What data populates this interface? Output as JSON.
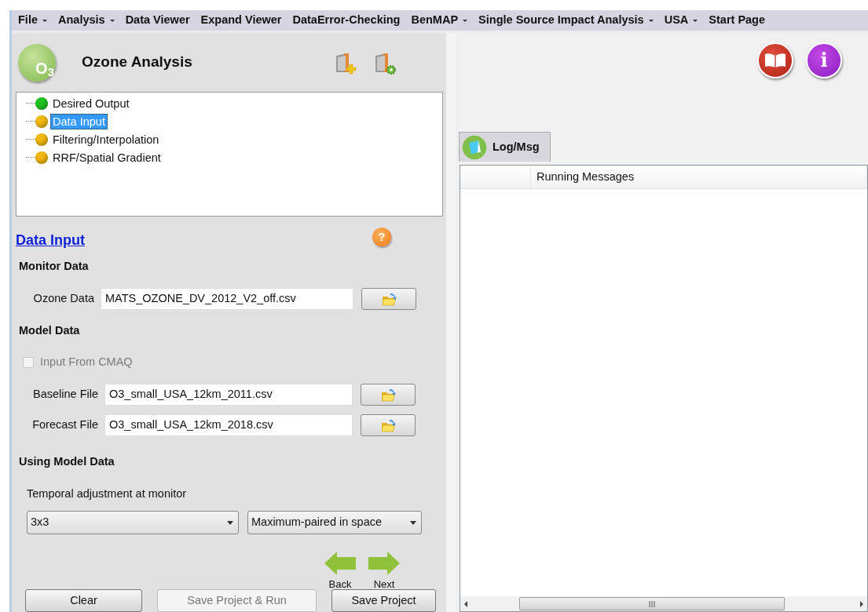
{
  "menu": [
    {
      "label": "File",
      "has_menu": true
    },
    {
      "label": "Analysis",
      "has_menu": true
    },
    {
      "label": "Data Viewer",
      "has_menu": false
    },
    {
      "label": "Expand Viewer",
      "has_menu": false
    },
    {
      "label": "DataError-Checking",
      "has_menu": false
    },
    {
      "label": "BenMAP",
      "has_menu": true
    },
    {
      "label": "Single Source Impact Analysis",
      "has_menu": true
    },
    {
      "label": "USA",
      "has_menu": true
    },
    {
      "label": "Start Page",
      "has_menu": false
    }
  ],
  "panel": {
    "title": "Ozone Analysis",
    "logo_text": "O",
    "logo_sub": "3"
  },
  "steps": [
    {
      "label": "Desired Output",
      "color": "#22c322",
      "selected": false
    },
    {
      "label": "Data Input",
      "color": "#f2b80f",
      "selected": true
    },
    {
      "label": "Filtering/Interpolation",
      "color": "#f2b80f",
      "selected": false
    },
    {
      "label": "RRF/Spatial Gradient",
      "color": "#f2b80f",
      "selected": false
    }
  ],
  "section": {
    "title": "Data Input",
    "help": "?"
  },
  "monitor": {
    "heading": "Monitor Data",
    "fields": [
      {
        "label": "Ozone Data",
        "value": "MATS_OZONE_DV_2012_V2_off.csv"
      }
    ]
  },
  "model": {
    "heading": "Model Data",
    "checkbox": {
      "label": "Input From CMAQ",
      "checked": false,
      "disabled": true
    },
    "fields": [
      {
        "label": "Baseline File",
        "value": "O3_small_USA_12km_2011.csv"
      },
      {
        "label": "Forecast File",
        "value": "O3_small_USA_12km_2018.csv"
      }
    ]
  },
  "using": {
    "heading": "Using Model Data",
    "label": "Temporal adjustment at monitor",
    "selects": [
      {
        "value": "3x3"
      },
      {
        "value": "Maximum-paired in space"
      }
    ]
  },
  "nav": {
    "back": "Back",
    "next": "Next"
  },
  "buttons": [
    {
      "label": "Clear",
      "disabled": false
    },
    {
      "label": "Save Project & Run",
      "disabled": true
    },
    {
      "label": "Save Project",
      "disabled": false
    }
  ],
  "info_icon": "i",
  "tabs": [
    {
      "label": "Log/Msg",
      "selected": true
    }
  ],
  "log": {
    "columns": [
      "",
      "Running Messages"
    ]
  }
}
